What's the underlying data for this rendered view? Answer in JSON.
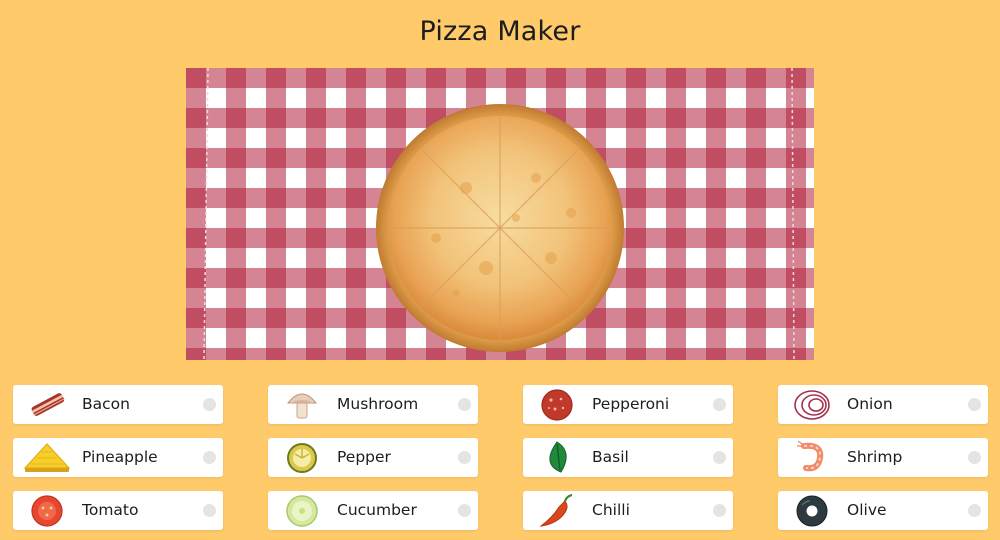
{
  "app": {
    "title": "Pizza Maker"
  },
  "colors": {
    "background": "#ffca6a",
    "tablecloth_red": "#b01e3a",
    "tablecloth_white": "#ffffff",
    "card": "#ffffff",
    "toggle_off": "#e4e4e4"
  },
  "toppings": [
    {
      "label": "Bacon",
      "icon": "bacon-icon",
      "selected": false
    },
    {
      "label": "Mushroom",
      "icon": "mushroom-icon",
      "selected": false
    },
    {
      "label": "Pepperoni",
      "icon": "pepperoni-icon",
      "selected": false
    },
    {
      "label": "Onion",
      "icon": "onion-icon",
      "selected": false
    },
    {
      "label": "Pineapple",
      "icon": "pineapple-icon",
      "selected": false
    },
    {
      "label": "Pepper",
      "icon": "pepper-icon",
      "selected": false
    },
    {
      "label": "Basil",
      "icon": "basil-icon",
      "selected": false
    },
    {
      "label": "Shrimp",
      "icon": "shrimp-icon",
      "selected": false
    },
    {
      "label": "Tomato",
      "icon": "tomato-icon",
      "selected": false
    },
    {
      "label": "Cucumber",
      "icon": "cucumber-icon",
      "selected": false
    },
    {
      "label": "Chilli",
      "icon": "chilli-icon",
      "selected": false
    },
    {
      "label": "Olive",
      "icon": "olive-icon",
      "selected": false
    }
  ]
}
